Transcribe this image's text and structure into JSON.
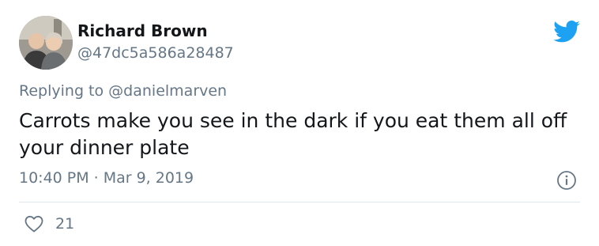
{
  "tweet": {
    "author_name": "Richard Brown",
    "author_handle": "@47dc5a586a28487",
    "replying_prefix": "Replying to",
    "replying_mention": "@danielmarven",
    "text": "Carrots make you see in the dark if you eat them all off your dinner plate",
    "time": "10:40 PM",
    "separator": "·",
    "date": "Mar 9, 2019",
    "like_count": "21"
  },
  "colors": {
    "brand": "#1da1f2",
    "secondary_text": "#657786",
    "divider": "#e1e8ed"
  },
  "icons": {
    "brand": "twitter-bird-icon",
    "info": "info-icon",
    "like": "heart-icon"
  }
}
